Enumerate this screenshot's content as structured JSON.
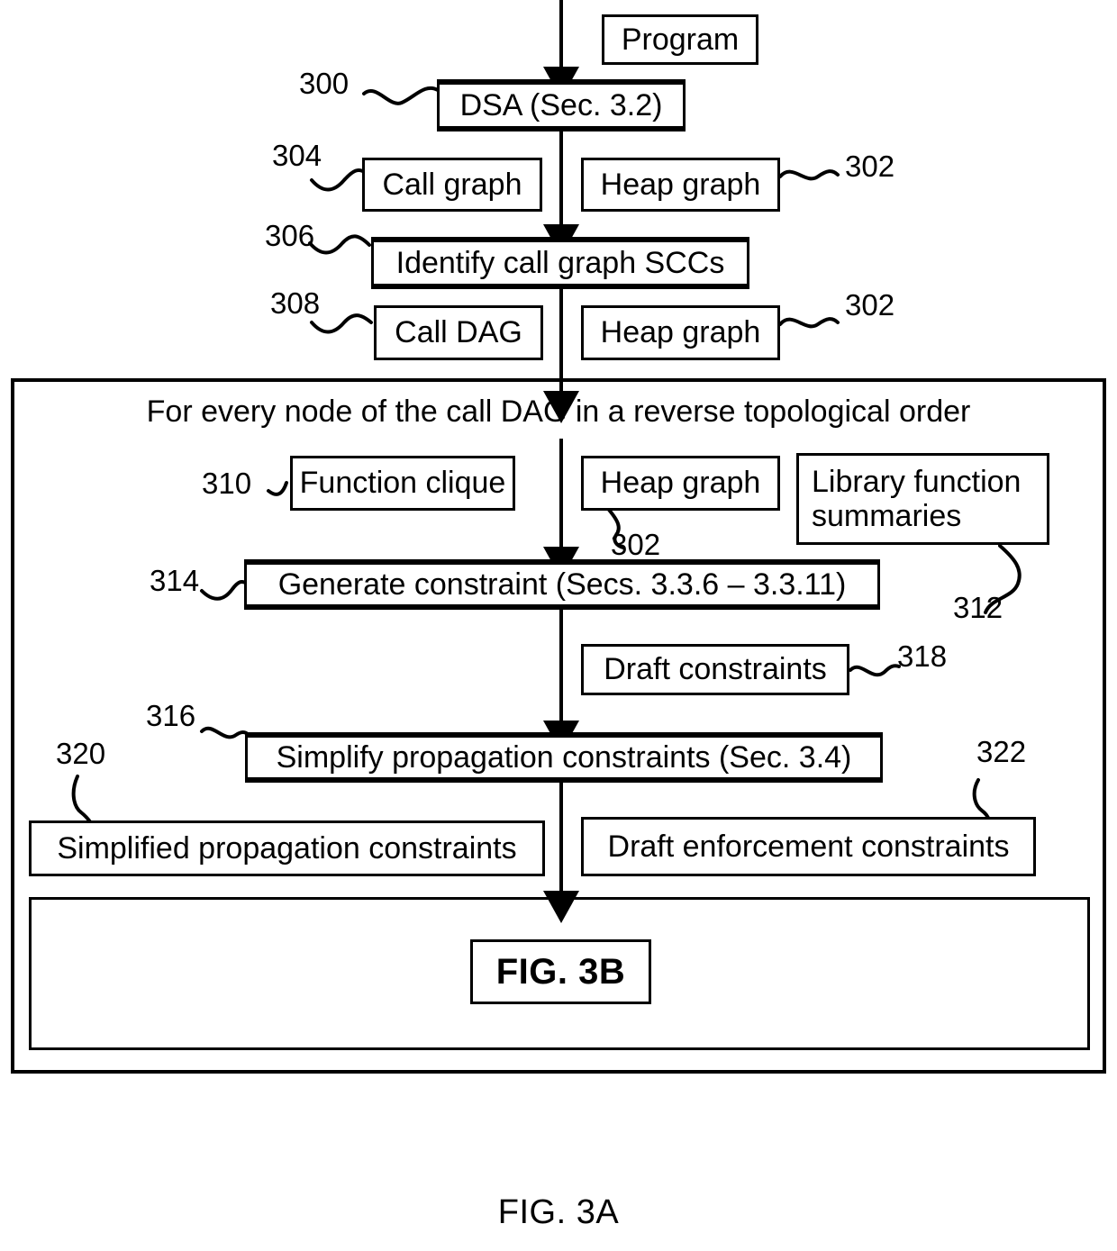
{
  "figure": {
    "caption": "FIG. 3A",
    "loop_label": "For every node of the call DAG in a reverse topological order",
    "continuation_label": "FIG. 3B"
  },
  "nodes": {
    "program": "Program",
    "dsa": "DSA (Sec. 3.2)",
    "call_graph": "Call graph",
    "heap_graph_top": "Heap graph",
    "identify_sccs": "Identify call graph SCCs",
    "call_dag": "Call DAG",
    "heap_graph_mid": "Heap graph",
    "function_clique": "Function clique",
    "heap_graph_inner": "Heap graph",
    "library_summaries": "Library function\nsummaries",
    "generate_constraint": "Generate constraint (Secs. 3.3.6 – 3.3.11)",
    "draft_constraints": "Draft constraints",
    "simplify_constraints": "Simplify propagation constraints (Sec. 3.4)",
    "simplified_propagation": "Simplified propagation constraints",
    "draft_enforcement": "Draft enforcement constraints"
  },
  "reference_numerals": {
    "dsa": "300",
    "heap_graph_top": "302",
    "call_graph": "304",
    "identify_sccs": "306",
    "call_dag": "308",
    "heap_graph_mid": "302",
    "function_clique": "310",
    "heap_graph_inner": "302",
    "library_summaries": "312",
    "generate_constraint": "314",
    "simplify_constraints": "316",
    "draft_constraints": "318",
    "simplified_propagation": "320",
    "draft_enforcement": "322"
  },
  "colors": {
    "line": "#000000",
    "background": "#ffffff"
  }
}
